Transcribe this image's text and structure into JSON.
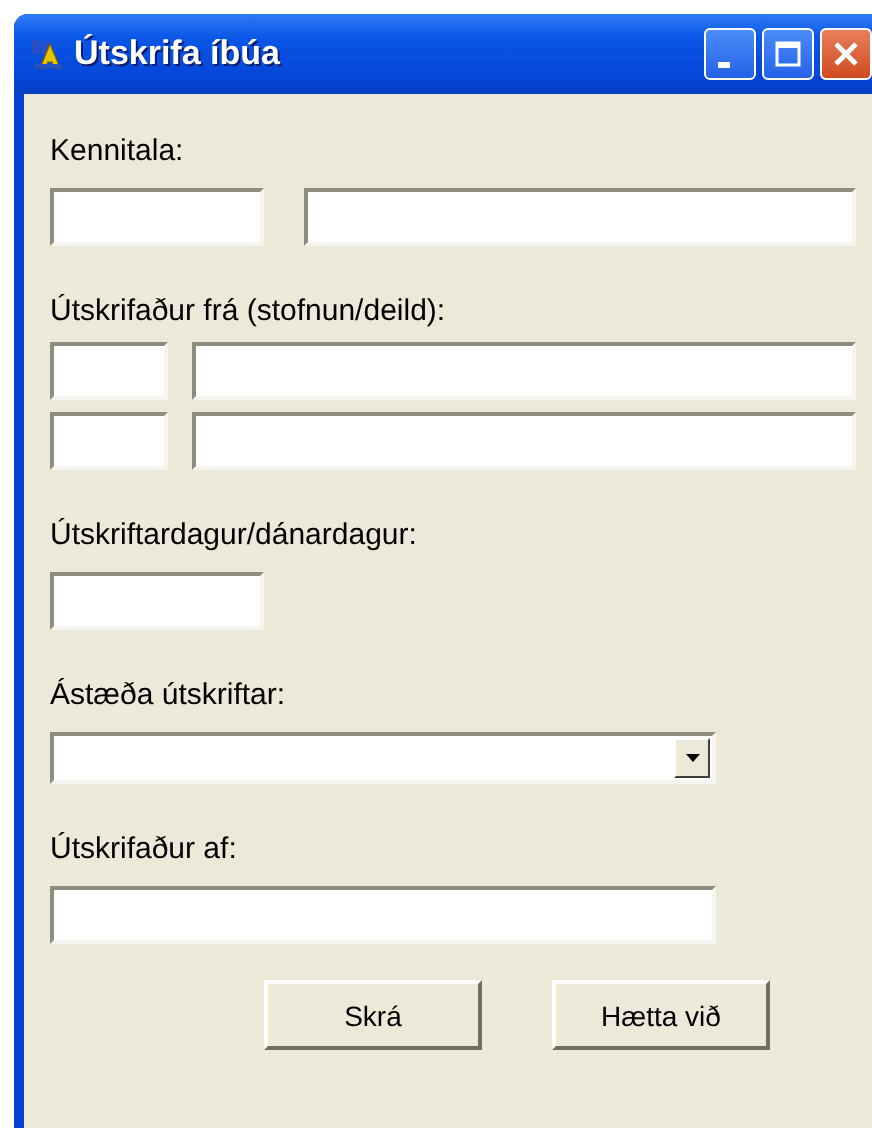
{
  "window": {
    "title": "Útskrifa íbúa"
  },
  "sections": [
    {
      "label": "Kennitala:",
      "kind": "pair"
    },
    {
      "label": "Útskrifaður frá (stofnun/deild):",
      "kind": "pair-rows"
    },
    {
      "label": "Útskriftardagur/dánardagur:",
      "kind": "short"
    },
    {
      "label": "Ástæða útskriftar:",
      "kind": "combo"
    },
    {
      "label": "Útskrifaður af:",
      "kind": "long"
    }
  ],
  "buttons": [
    "Skrá",
    "Hætta við"
  ]
}
